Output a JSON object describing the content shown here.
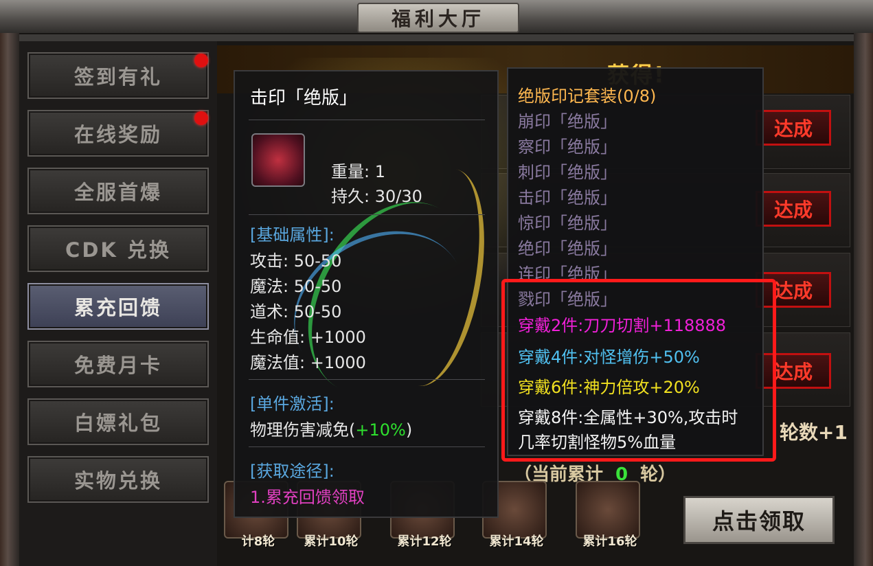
{
  "window": {
    "title": "福利大厅"
  },
  "sidebar": {
    "items": [
      {
        "label": "签到有礼",
        "badge": true,
        "active": false
      },
      {
        "label": "在线奖励",
        "badge": true,
        "active": false
      },
      {
        "label": "全服首爆",
        "badge": false,
        "active": false
      },
      {
        "label": "CDK 兑换",
        "badge": false,
        "active": false
      },
      {
        "label": "累充回馈",
        "badge": false,
        "active": true
      },
      {
        "label": "免费月卡",
        "badge": false,
        "active": false
      },
      {
        "label": "白嫖礼包",
        "badge": false,
        "active": false
      },
      {
        "label": "实物兑换",
        "badge": false,
        "active": false
      }
    ]
  },
  "main": {
    "banner_text": "获得!",
    "reach_label": "达成",
    "rounds_text": "轮数+1",
    "progress_prefix": "（当前累计",
    "progress_value": "0",
    "progress_suffix": "轮）",
    "claim_label": "点击领取",
    "rewards": [
      "计8轮",
      "累计10轮",
      "累计12轮",
      "累计14轮",
      "累计16轮"
    ]
  },
  "item_tooltip": {
    "name": "击印「绝版」",
    "weight_label": "重量: 1",
    "durability_label": "持久: 30/30",
    "base_header": "[基础属性]:",
    "stats": [
      "攻击: 50-50",
      "魔法: 50-50",
      "道术: 50-50",
      "生命值: +1000",
      "魔法值: +1000"
    ],
    "single_header": "[单件激活]:",
    "single_effect_text": "物理伤害减免(",
    "single_effect_value": "+10%",
    "single_effect_close": ")",
    "source_header": "[获取途径]:",
    "source_text": "1.累充回馈领取"
  },
  "set_tooltip": {
    "title": "绝版印记套装(0/8)",
    "items": [
      "崩印「绝版」",
      "察印「绝版」",
      "刺印「绝版」",
      "击印「绝版」",
      "惊印「绝版」",
      "绝印「绝版」",
      "连印「绝版」",
      "戮印「绝版」"
    ],
    "bonus_2": "穿戴2件:刀刀切割+118888",
    "bonus_4": "穿戴4件:对怪增伤+50%",
    "bonus_6": "穿戴6件:神力倍攻+20%",
    "bonus_8_line1": "穿戴8件:全属性+30%,攻击时",
    "bonus_8_line2": "几率切割怪物5%血量"
  },
  "colors": {
    "highlight_box": "#ff1a1a",
    "set_title": "#ffb850",
    "bonus2": "#f020d8",
    "bonus4": "#50c0f0",
    "bonus6": "#f0e020"
  }
}
